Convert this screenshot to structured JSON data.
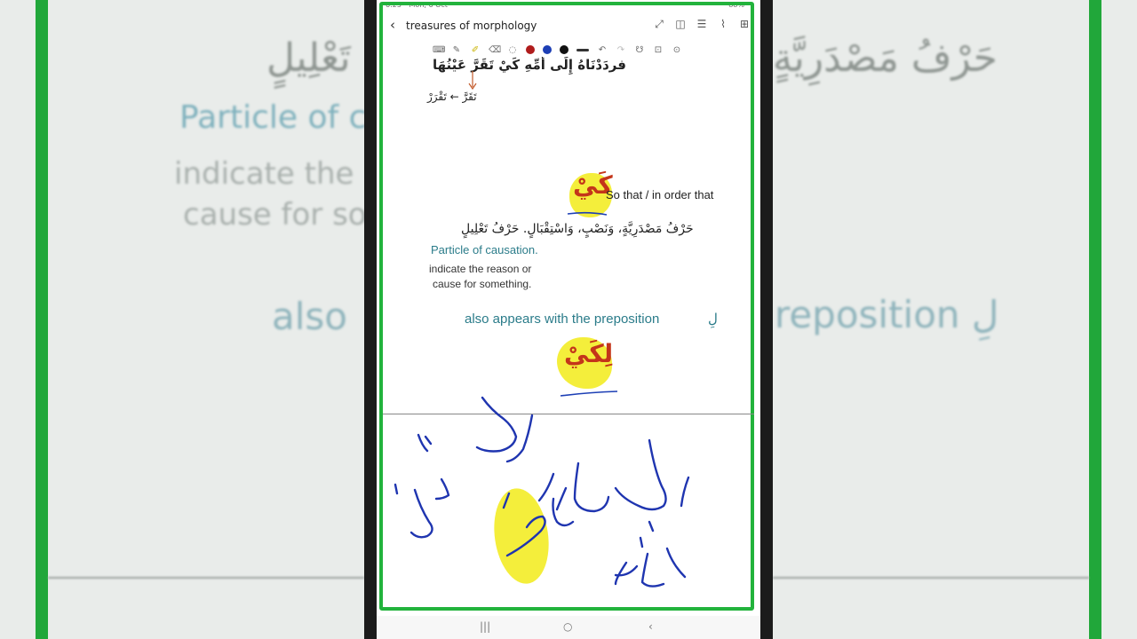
{
  "status": {
    "time": "6:25",
    "date": "Mon, 6 Oct",
    "battery": "88%"
  },
  "app": {
    "title": "treasures of morphology"
  },
  "toolbar": {
    "colors": [
      "#b01c1c",
      "#1d3fb5",
      "#111111"
    ]
  },
  "note": {
    "top_arabic": "فردَدْنَاهُ إِلَى أُمِّهِ كَيْ تَقَرَّ عَيْنُهَا",
    "derivation": "تَقَرَّ ← تَقْرَرْ",
    "kay_word": "كَيْ",
    "kay_meaning": "So that / in order that",
    "arabic_desc": "حَرْفُ مَصْدَرِيَّةٍ، وَنَصْبٍ، وَاسْتِقْبَالٍ. حَرْفُ تَعْلِيلٍ",
    "particle_title": "Particle of causation.",
    "indicate_line1": "indicate the reason or",
    "indicate_line2": "cause for something.",
    "also_text": "also appears with the preposition",
    "preposition": "لِ",
    "likay_word": "لِكَيْ"
  },
  "background": {
    "left_arabic": "تَعْلِيلٍ",
    "left_particle": "Particle of c",
    "left_indicate1": "indicate the",
    "left_indicate2": "cause for so",
    "left_also": "also",
    "right_arabic": "حَرْفُ مَصْدَرِيَّةٍ",
    "right_preposition": "reposition لِ"
  }
}
